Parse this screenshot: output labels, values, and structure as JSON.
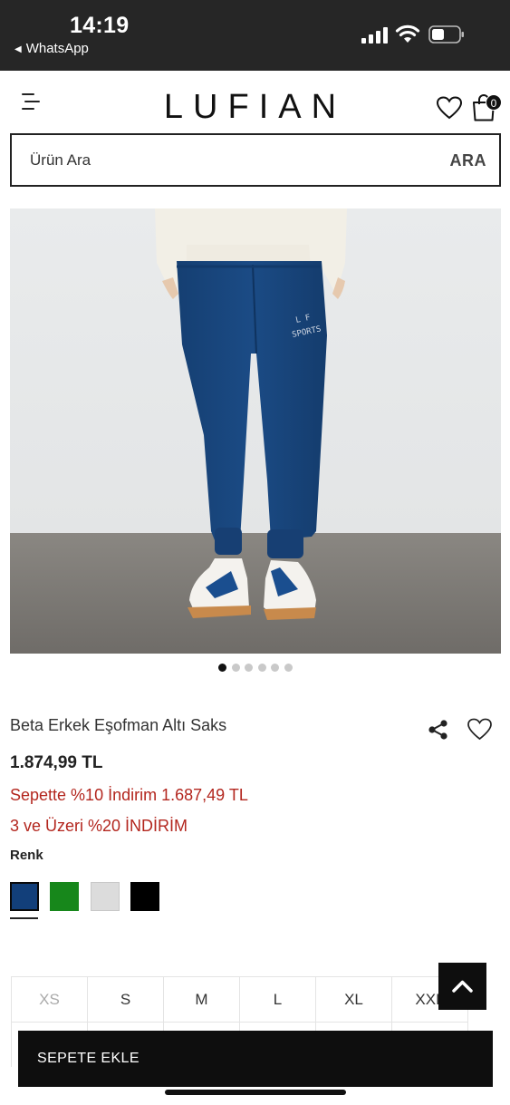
{
  "status_bar": {
    "time": "14:19",
    "back_app": "WhatsApp",
    "back_glyph": "◀"
  },
  "header": {
    "logo": "LUFIAN",
    "cart_count": "0"
  },
  "search": {
    "placeholder": "Ürün Ara",
    "button_label": "ARA"
  },
  "gallery": {
    "image_count": 6,
    "active_index": 0
  },
  "product": {
    "title": "Beta Erkek Eşofman Altı Saks",
    "price": "1.874,99 TL",
    "promo_basket": "Sepette %10 İndirim 1.687,49 TL",
    "promo_bulk": "3 ve Üzeri %20 İNDİRİM",
    "color_label": "Renk",
    "print_text_line1": "L F",
    "print_text_line2": "SPORTS"
  },
  "colors": [
    {
      "name": "navy",
      "hex": "#123f7a",
      "selected": true
    },
    {
      "name": "green",
      "hex": "#17871b",
      "selected": false
    },
    {
      "name": "light-grey",
      "hex": "#dcdcdc",
      "selected": false
    },
    {
      "name": "black",
      "hex": "#000000",
      "selected": false
    }
  ],
  "sizes": [
    {
      "label": "XS",
      "available": false
    },
    {
      "label": "S",
      "available": true
    },
    {
      "label": "M",
      "available": true
    },
    {
      "label": "L",
      "available": true
    },
    {
      "label": "XL",
      "available": true
    },
    {
      "label": "XXL",
      "available": true
    }
  ],
  "actions": {
    "add_to_cart": "SEPETE EKLE"
  },
  "theme": {
    "accent_red": "#b3261e",
    "dark": "#0e0e0e",
    "status_bar_bg": "#262626"
  }
}
